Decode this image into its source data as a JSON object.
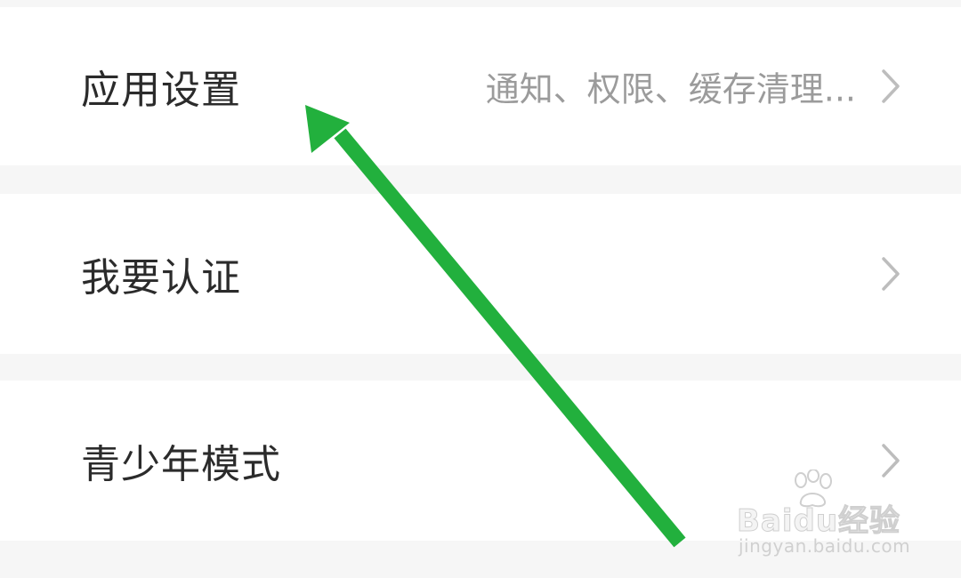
{
  "settings": {
    "rows": [
      {
        "label": "应用设置",
        "value": "通知、权限、缓存清理..."
      },
      {
        "label": "我要认证",
        "value": ""
      },
      {
        "label": "青少年模式",
        "value": ""
      }
    ]
  },
  "annotation": {
    "arrow_color": "#22b03d",
    "arrow_icon": "green-arrow-icon"
  },
  "watermark": {
    "brand": "Baidu经验",
    "site": "jingyan.baidu.com"
  },
  "colors": {
    "row_background": "#ffffff",
    "separator_background": "#f6f6f6",
    "label_text": "#2b2b2b",
    "value_text": "#9b9b9b",
    "chevron": "#bdbdbd"
  }
}
